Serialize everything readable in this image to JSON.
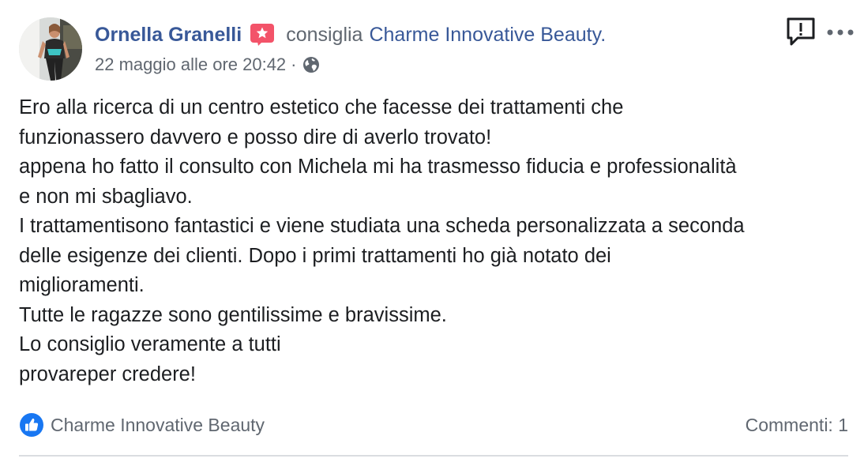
{
  "post": {
    "author": "Ornella Granelli",
    "verb": "consiglia",
    "page_name": "Charme Innovative Beauty.",
    "timestamp": "22 maggio alle ore 20:42",
    "meta_separator": "·",
    "body_lines": [
      "Ero alla ricerca di un centro estetico che facesse dei trattamenti che",
      "funzionassero davvero e posso dire di averlo trovato!",
      "appena ho fatto il consulto con Michela mi ha trasmesso fiducia e professionalità",
      "e non mi sbagliavo.",
      "I trattamentisono fantastici e viene studiata una scheda personalizzata a seconda",
      "delle esigenze dei clienti. Dopo i primi trattamenti ho già notato dei",
      "miglioramenti.",
      "Tutte le ragazze sono gentilissime e bravissime.",
      "Lo consiglio veramente a tutti",
      "provareper credere!"
    ],
    "liker": "Charme Innovative Beauty",
    "comments_label": "Commenti: 1"
  },
  "icons": {
    "recommend_badge": "star-badge-icon",
    "audience": "globe-icon",
    "report": "report-icon",
    "more": "more-icon",
    "like": "like-icon"
  },
  "colors": {
    "link_blue": "#385898",
    "secondary_gray": "#606770",
    "text": "#1c1e21",
    "badge_pink": "#f35369",
    "like_blue": "#1877f2",
    "divider": "#dadde1"
  }
}
